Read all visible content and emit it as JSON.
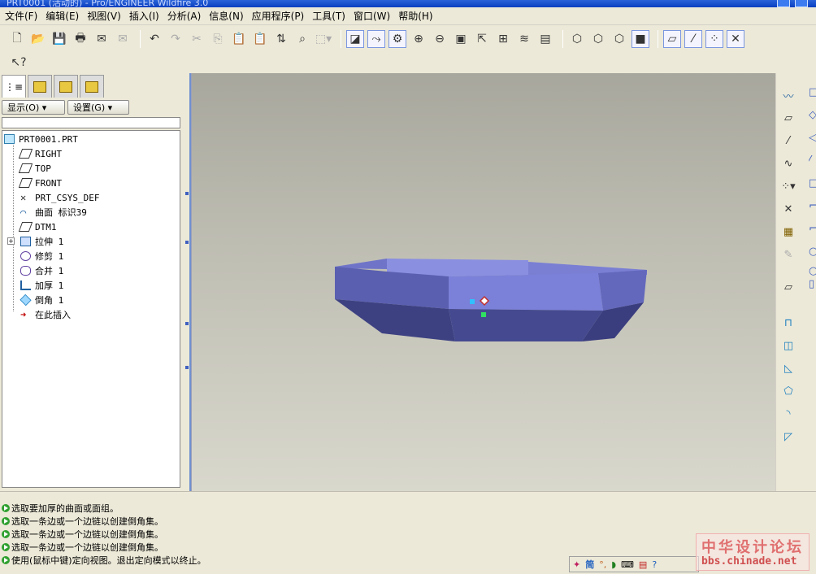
{
  "window": {
    "title": "PRT0001 (活动的) - Pro/ENGINEER Wildfire 3.0"
  },
  "menu": [
    "文件(F)",
    "编辑(E)",
    "视图(V)",
    "插入(I)",
    "分析(A)",
    "信息(N)",
    "应用程序(P)",
    "工具(T)",
    "窗口(W)",
    "帮助(H)"
  ],
  "panel": {
    "show_label": "显示(O) ▾",
    "settings_label": "设置(G) ▾"
  },
  "tree": {
    "root": "PRT0001.PRT",
    "items": [
      "RIGHT",
      "TOP",
      "FRONT",
      "PRT_CSYS_DEF",
      "曲面 标识39",
      "DTM1",
      "拉伸 1",
      "修剪 1",
      "合并 1",
      "加厚 1",
      "倒角 1",
      "在此插入"
    ]
  },
  "messages": [
    "选取要加厚的曲面或面组。",
    "选取一条边或一个边链以创建倒角集。",
    "选取一条边或一个边链以创建倒角集。",
    "选取一条边或一个边链以创建倒角集。",
    "使用(鼠标中键)定向视图。退出定向模式以终止。"
  ],
  "watermark": {
    "line1": "中华设计论坛",
    "line2": "bbs.chinade.net"
  },
  "colors": {
    "model_top": "#7b80d8",
    "model_side": "#4a4e96",
    "model_dark": "#3a3d7e",
    "titlebar": "#0a3fc0"
  }
}
